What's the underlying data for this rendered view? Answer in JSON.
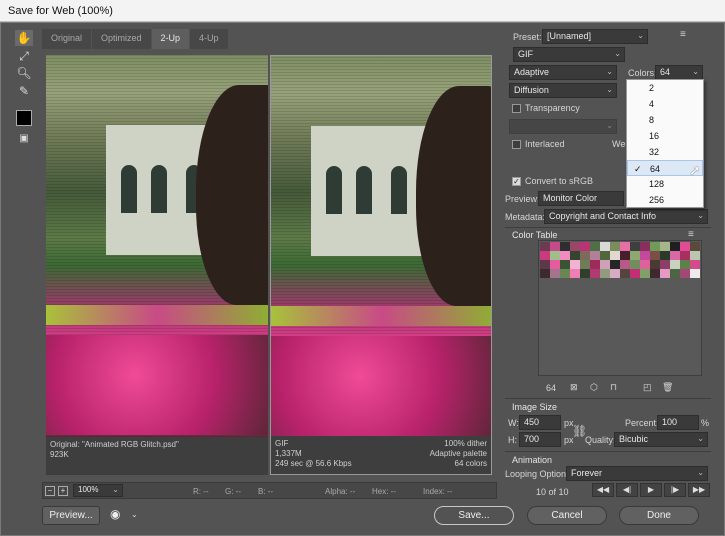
{
  "window": {
    "title": "Save for Web (100%)"
  },
  "tabs": [
    "Original",
    "Optimized",
    "2-Up",
    "4-Up"
  ],
  "left_pane": {
    "line1": "Original: \"Animated RGB Glitch.psd\"",
    "line2": "923K"
  },
  "right_pane": {
    "format": "GIF",
    "size": "1,337M",
    "time": "249 sec @ 56.6 Kbps",
    "dither": "100% dither",
    "palette": "Adaptive palette",
    "colors": "64 colors"
  },
  "settings": {
    "preset_label": "Preset:",
    "preset_value": "[Unnamed]",
    "format": "GIF",
    "reduction": "Adaptive",
    "colors_label": "Colors:",
    "colors_value": "64",
    "dither": "Diffusion",
    "transparency": "Transparency",
    "interlaced": "Interlaced",
    "web_partial": "Web",
    "convert_srgb": "Convert to sRGB",
    "preview_label": "Preview:",
    "preview_value": "Monitor Color",
    "metadata_label": "Metadata:",
    "metadata_value": "Copyright and Contact Info"
  },
  "colors_dropdown": [
    "2",
    "4",
    "8",
    "16",
    "32",
    "64",
    "128",
    "256"
  ],
  "colors_checkmark": "✓",
  "color_table": {
    "title": "Color Table",
    "count": "64"
  },
  "image_size": {
    "title": "Image Size",
    "w_label": "W:",
    "w_value": "450",
    "h_label": "H:",
    "h_value": "700",
    "unit": "px",
    "percent_label": "Percent:",
    "percent_value": "100",
    "percent_unit": "%",
    "quality_label": "Quality:",
    "quality_value": "Bicubic"
  },
  "animation": {
    "title": "Animation",
    "looping_label": "Looping Options:",
    "looping_value": "Forever",
    "frame_counter": "10 of 10"
  },
  "statusbar": {
    "zoom": "100%",
    "r": "R: --",
    "g": "G: --",
    "b": "B: --",
    "alpha": "Alpha: --",
    "hex": "Hex: --",
    "index": "Index: --"
  },
  "buttons": {
    "preview": "Preview...",
    "save": "Save...",
    "cancel": "Cancel",
    "done": "Done"
  },
  "swatch_colors": [
    "#6b3b52",
    "#c64b8b",
    "#2e2e2e",
    "#9a4668",
    "#b93476",
    "#4f6f45",
    "#d9d9d9",
    "#7c8d5c",
    "#e66fa6",
    "#3f3f3f",
    "#8a2f5c",
    "#6f9a57",
    "#a6b58c",
    "#1f1f1f",
    "#e24b96",
    "#5a4a3c",
    "#cc3a7e",
    "#9fbf8a",
    "#f08cc0",
    "#36432f",
    "#7a6b5b",
    "#b27f9a",
    "#52663c",
    "#e3d8d0",
    "#451f2e",
    "#8ea870",
    "#c24a9d",
    "#7a5046",
    "#2a3a28",
    "#d76aa4",
    "#a73060",
    "#bcc6ae",
    "#5d3848",
    "#e85a9f",
    "#3b5534",
    "#f3b2d2",
    "#6e7d58",
    "#9e2c5a",
    "#cfa0b8",
    "#262626",
    "#b85a88",
    "#708f5f",
    "#e0609c",
    "#4a3a34",
    "#8c3f66",
    "#c9d2c0",
    "#5f8049",
    "#d04c8b",
    "#3d2a30",
    "#a4748c",
    "#6a8652",
    "#f07db4",
    "#2f3f2c",
    "#b23a72",
    "#919c7d",
    "#d9aac3",
    "#54463c",
    "#c52e75",
    "#7fa166",
    "#402830",
    "#e59ac3",
    "#4b6641",
    "#a34876",
    "#ebebeb"
  ]
}
